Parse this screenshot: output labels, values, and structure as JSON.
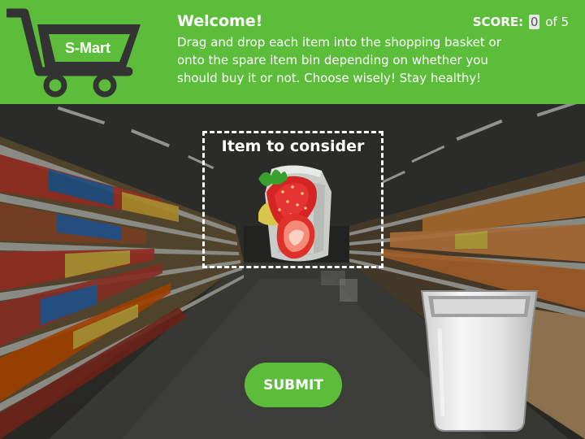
{
  "header": {
    "logo_text": "S-Mart",
    "title": "Welcome!",
    "instructions": "Drag and drop each item into the shopping basket or onto the spare item bin depending on whether you should buy it or not. Choose wisely! Stay healthy!",
    "score_label": "SCORE:",
    "score_value": "0",
    "score_total": "of 5"
  },
  "item": {
    "title": "Item to consider",
    "icon": "strawberry-milk-can-icon"
  },
  "submit": {
    "label": "SUBMIT"
  },
  "bin": {
    "icon": "trash-bin-icon"
  },
  "colors": {
    "brand_green": "#5cbd3b",
    "logo_dark": "#333333",
    "text": "#ffffff"
  }
}
